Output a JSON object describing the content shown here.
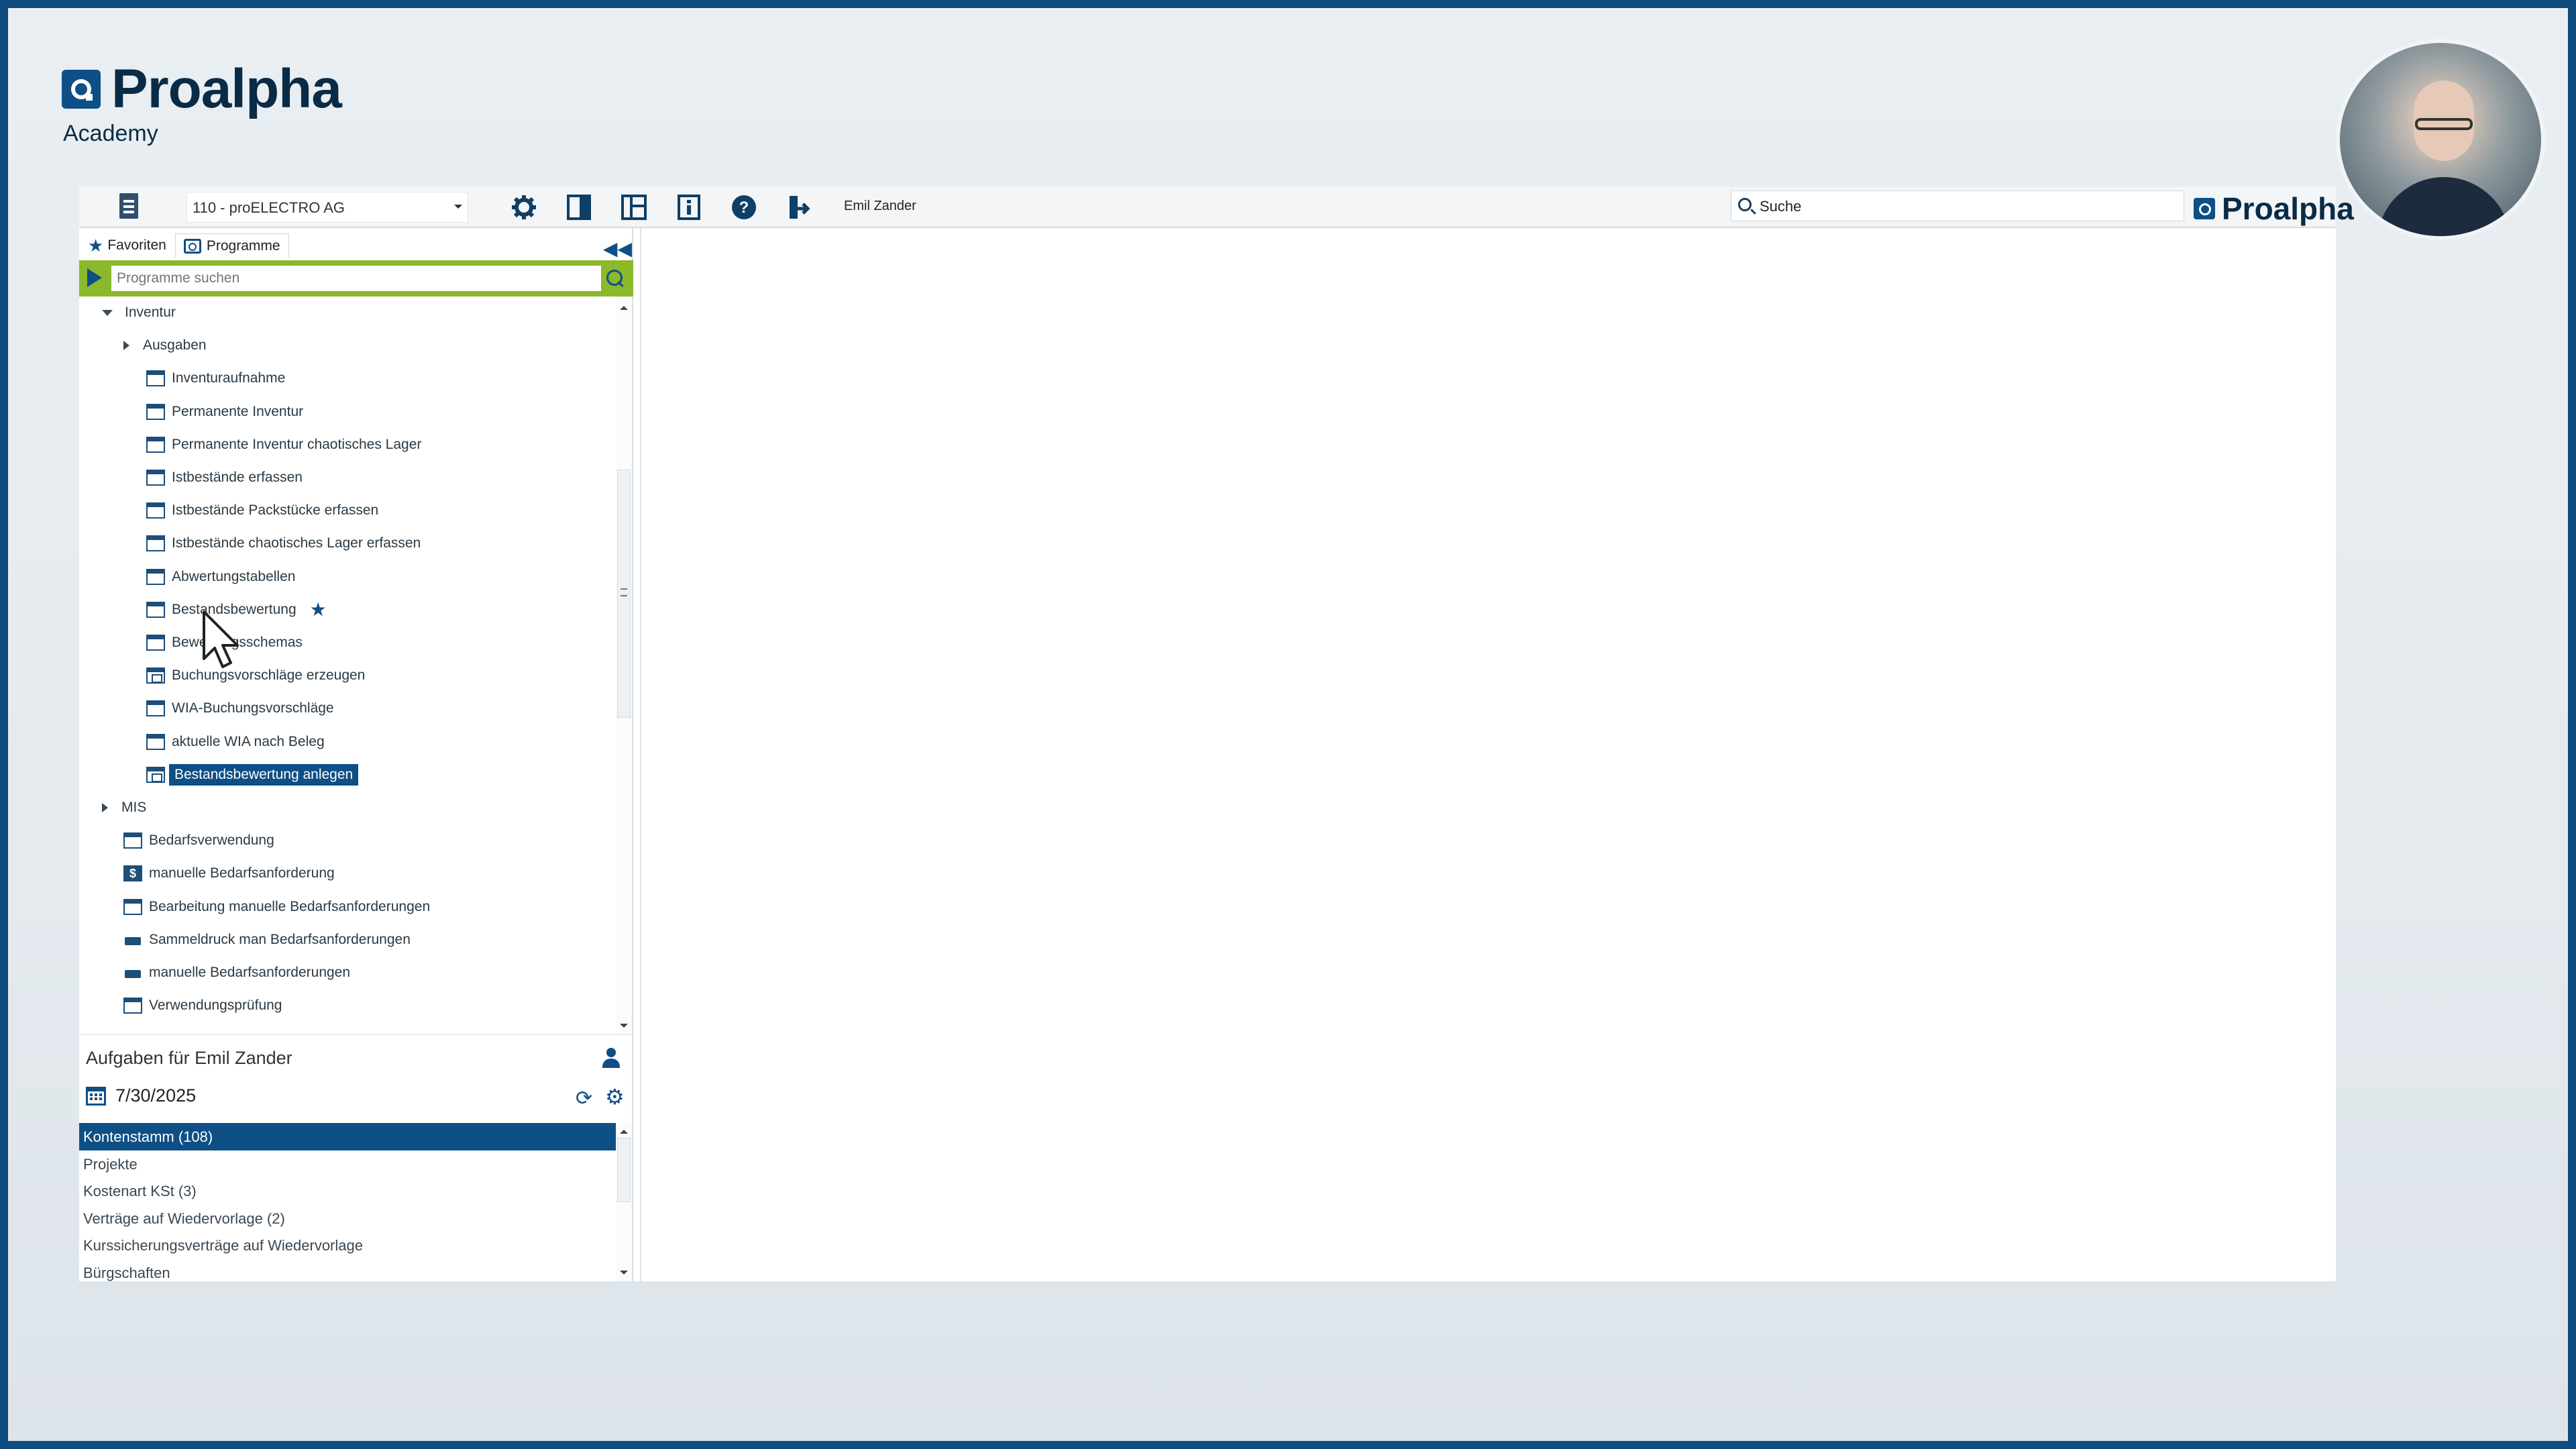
{
  "brand": {
    "name": "Proalpha",
    "subtitle": "Academy"
  },
  "toolbar": {
    "company": "110 - proELECTRO AG",
    "user": "Emil Zander",
    "search_value": "Suche",
    "brand_right": "Proalpha",
    "icons": [
      "document-icon",
      "gear-icon",
      "split-view-icon",
      "layout-icon",
      "info-icon",
      "help-icon",
      "logout-icon"
    ]
  },
  "nav": {
    "tabs": [
      {
        "label": "Favoriten",
        "icon": "star-icon"
      },
      {
        "label": "Programme",
        "icon": "programs-icon",
        "active": true
      }
    ],
    "search_placeholder": "Programme suchen",
    "tree": [
      {
        "label": "Inventur",
        "type": "folder-open",
        "level": 1
      },
      {
        "label": "Ausgaben",
        "type": "folder-closed",
        "level": 2
      },
      {
        "label": "Inventuraufnahme",
        "type": "window",
        "level": 3
      },
      {
        "label": "Permanente Inventur",
        "type": "window",
        "level": 3
      },
      {
        "label": "Permanente Inventur chaotisches Lager",
        "type": "window",
        "level": 3
      },
      {
        "label": "Istbestände erfassen",
        "type": "window",
        "level": 3
      },
      {
        "label": "Istbestände Packstücke erfassen",
        "type": "window",
        "level": 3
      },
      {
        "label": "Istbestände chaotisches Lager erfassen",
        "type": "window",
        "level": 3
      },
      {
        "label": "Abwertungstabellen",
        "type": "window",
        "level": 3
      },
      {
        "label": "Bestandsbewertung",
        "type": "window",
        "level": 3,
        "favorite": true
      },
      {
        "label": "Bewertungsschemas",
        "type": "window",
        "level": 3
      },
      {
        "label": "Buchungsvorschläge erzeugen",
        "type": "window-gear",
        "level": 3
      },
      {
        "label": "WIA-Buchungsvorschläge",
        "type": "window",
        "level": 3
      },
      {
        "label": "aktuelle WIA nach Beleg",
        "type": "window",
        "level": 3
      },
      {
        "label": "Bestandsbewertung anlegen",
        "type": "window-gear",
        "level": 3,
        "selected": true
      },
      {
        "label": "MIS",
        "type": "folder-closed",
        "level": 1
      },
      {
        "label": "Bedarfsverwendung",
        "type": "window",
        "level": 2
      },
      {
        "label": "manuelle Bedarfsanforderung",
        "type": "dollar",
        "level": 2
      },
      {
        "label": "Bearbeitung manuelle Bedarfsanforderungen",
        "type": "window",
        "level": 2
      },
      {
        "label": "Sammeldruck man Bedarfsanforderungen",
        "type": "print",
        "level": 2
      },
      {
        "label": "manuelle Bedarfsanforderungen",
        "type": "print",
        "level": 2
      },
      {
        "label": "Verwendungsprüfung",
        "type": "window",
        "level": 2
      }
    ]
  },
  "tasks": {
    "title": "Aufgaben für Emil Zander",
    "date": "7/30/2025",
    "items": [
      {
        "label": "Kontenstamm (108)",
        "active": true
      },
      {
        "label": "Projekte"
      },
      {
        "label": "Kostenart KSt (3)"
      },
      {
        "label": "Verträge auf Wiedervorlage (2)"
      },
      {
        "label": "Kurssicherungsverträge auf Wiedervorlage"
      },
      {
        "label": "Bürgschaften"
      }
    ]
  }
}
